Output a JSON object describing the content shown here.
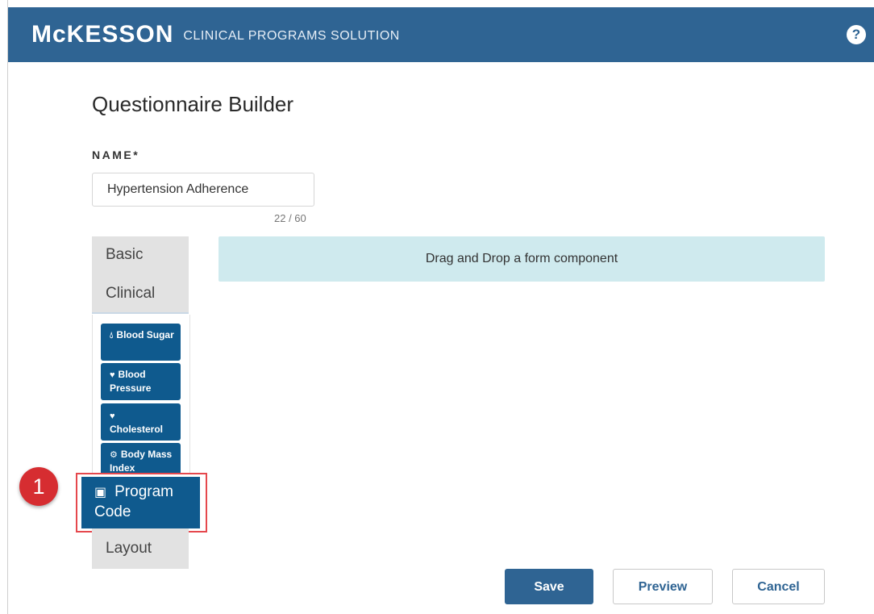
{
  "header": {
    "logo": "McKESSON",
    "product": "CLINICAL PROGRAMS SOLUTION",
    "help_icon": "question-circle-icon",
    "help_glyph": "?"
  },
  "page": {
    "title": "Questionnaire Builder"
  },
  "form": {
    "name_label": "NAME*",
    "name_value": "Hypertension Adherence",
    "counter": "22 / 60"
  },
  "tabs": {
    "basic": "Basic",
    "clinical": "Clinical",
    "layout": "Layout"
  },
  "components": [
    {
      "label": "Blood Sugar",
      "icon": "drop-icon"
    },
    {
      "label": "Blood Pressure",
      "icon": "heartbeat-icon"
    },
    {
      "label": "Cholesterol",
      "icon": "heart-icon"
    },
    {
      "label": "Body Mass Index",
      "icon": "weight-icon"
    }
  ],
  "program_code": {
    "label": "Program Code",
    "icon": "medkit-icon"
  },
  "callout": {
    "number": "1"
  },
  "dropzone": {
    "text": "Drag and Drop a form component"
  },
  "actions": {
    "save": "Save",
    "preview": "Preview",
    "cancel": "Cancel"
  },
  "colors": {
    "header": "#2f6493",
    "component": "#0f5a8e",
    "dropzone": "#cfeaee",
    "callout": "#d62d31"
  }
}
